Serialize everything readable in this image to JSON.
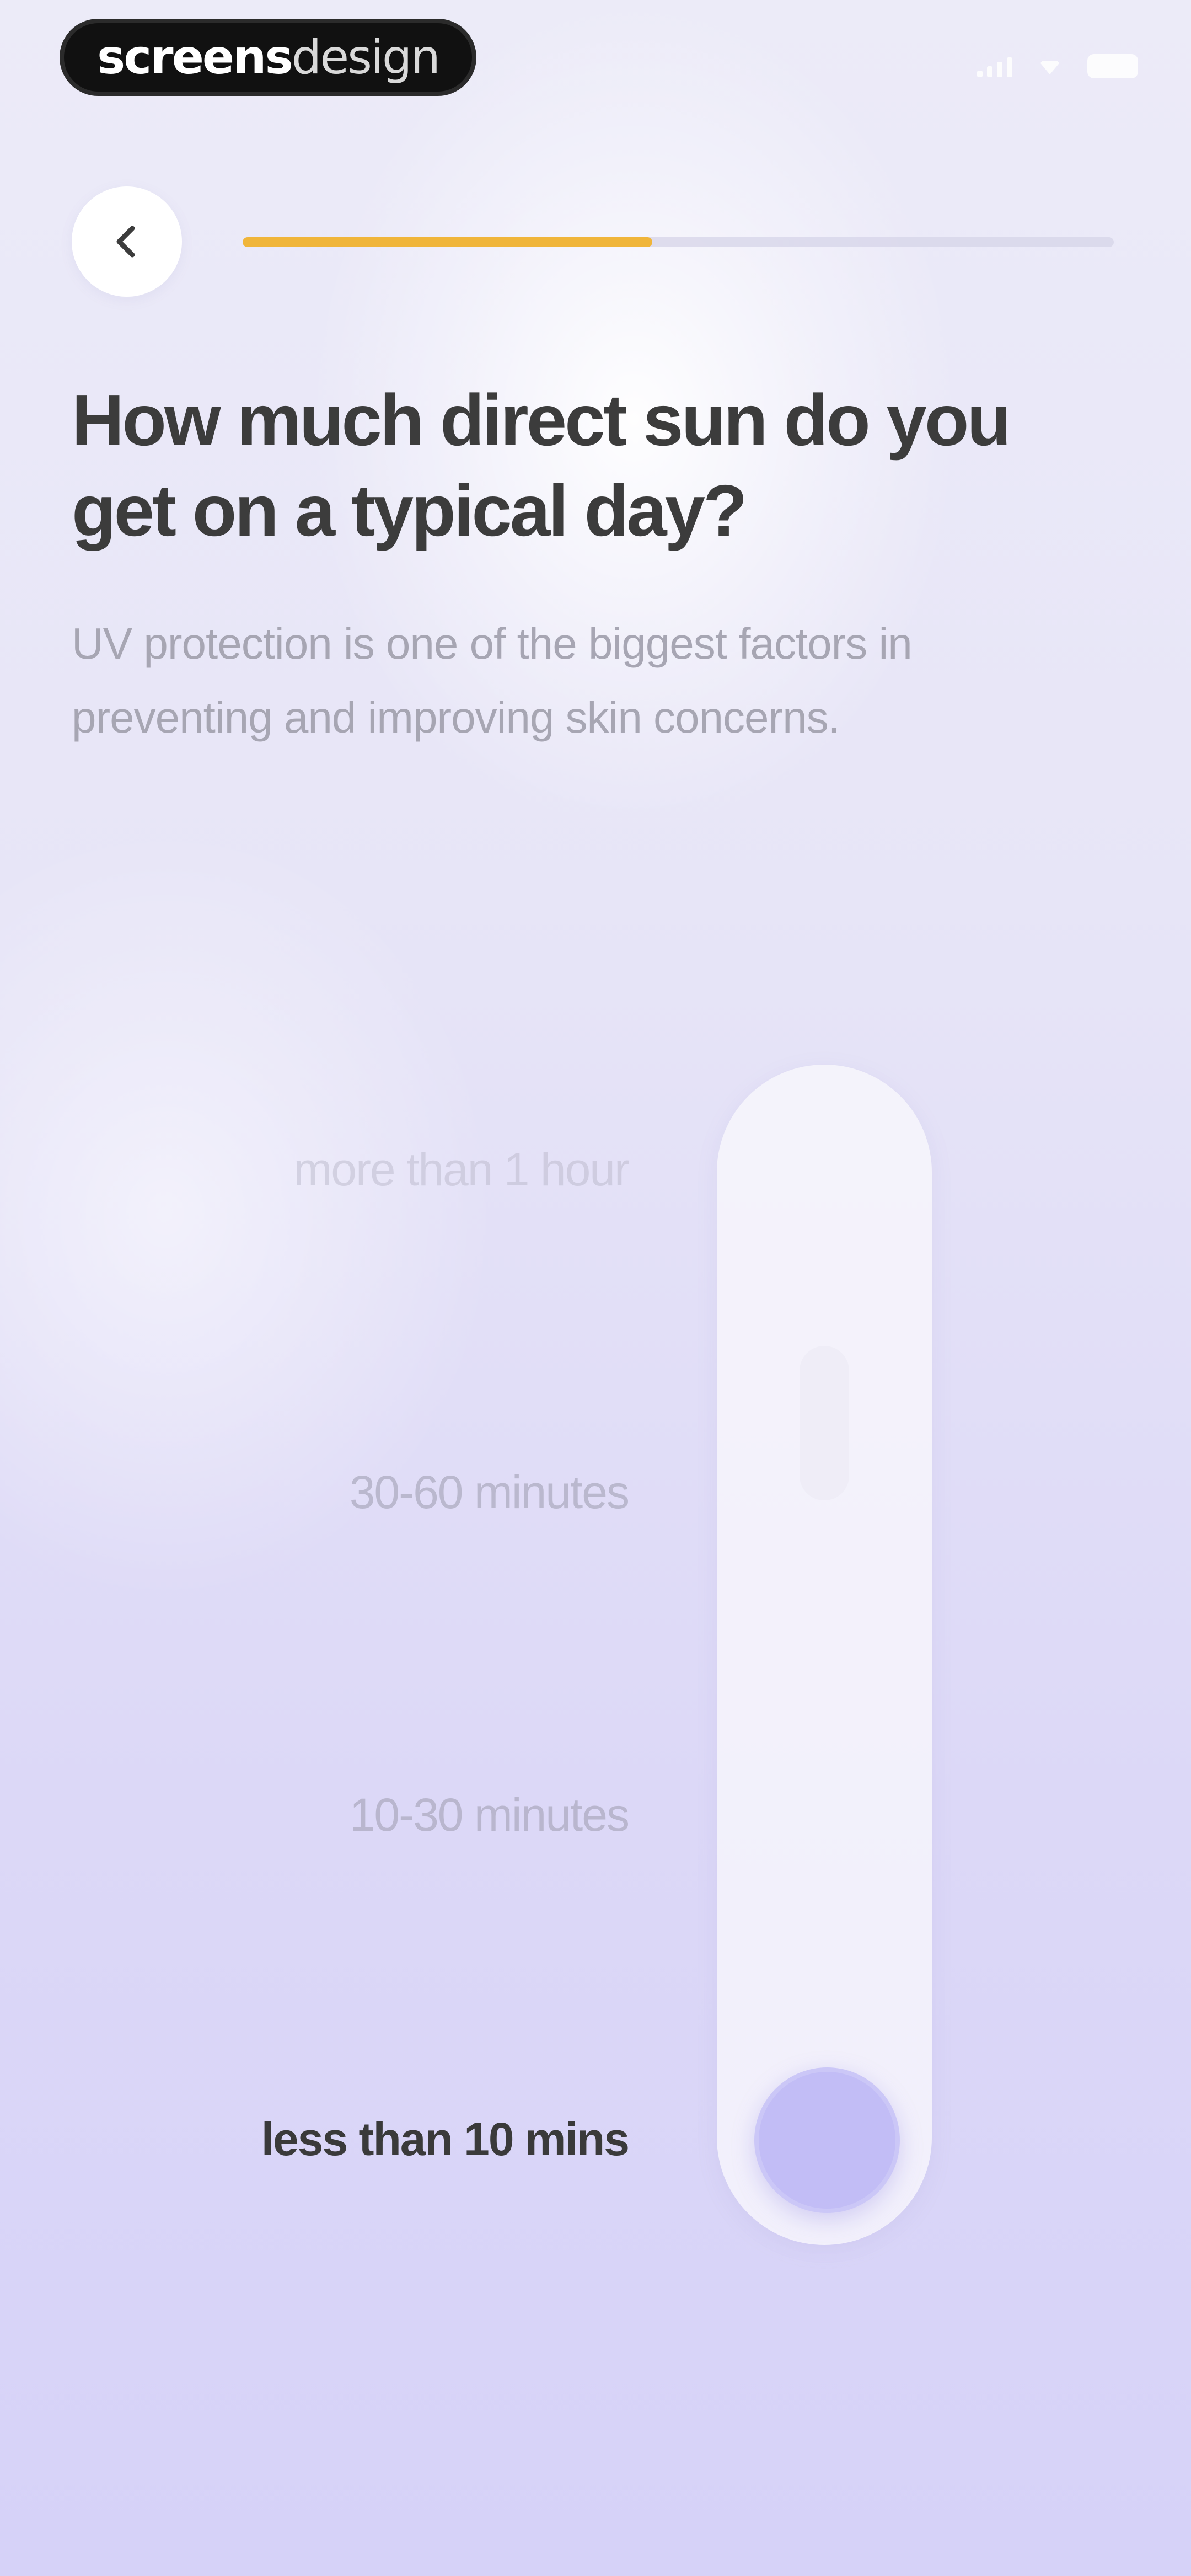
{
  "status_bar": {
    "brand_bold": "screens",
    "brand_light": "design"
  },
  "header": {
    "back_icon": "chevron-left-icon",
    "progress_fraction": 0.47,
    "progress_color": "#f0b53a"
  },
  "question": {
    "title": "How much direct sun do you get on a typical day?",
    "subtitle": "UV protection is one of the biggest factors in preventing and improving skin concerns."
  },
  "slider": {
    "options": [
      "more than 1 hour",
      "30-60 minutes",
      "10-30 minutes",
      "less than 10 mins"
    ],
    "selected": "less than 10 mins",
    "thumb_color": "#c2bdf6"
  }
}
